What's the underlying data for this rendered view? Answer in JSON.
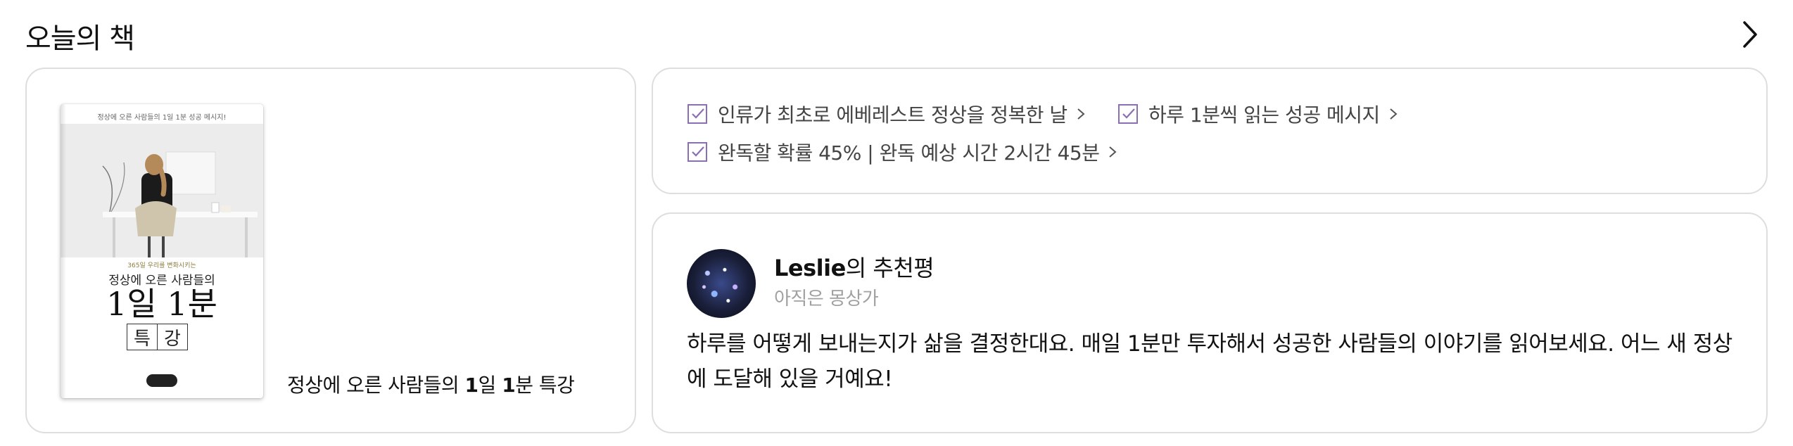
{
  "section": {
    "title": "오늘의 책",
    "more_icon": "chevron-right-icon"
  },
  "book": {
    "cover": {
      "top_text": "정상에 오른 사람들의 1일 1분 성공 메시지!",
      "subtitle": "365일 우리를 변화시키는",
      "title_line1": "정상에 오른 사람들의",
      "title_line2": "1일 1분",
      "title_char1": "특",
      "title_char2": "강"
    },
    "caption_prefix": "정상에 오른 사람들의 ",
    "caption_bold1": "1",
    "caption_mid": "일 ",
    "caption_bold2": "1",
    "caption_suffix": "분 특강"
  },
  "tags": [
    {
      "label": "인류가 최초로 에베레스트 정상을 정복한 날",
      "icon": "checkbox-icon"
    },
    {
      "label": "하루 1분씩 읽는 성공 메시지",
      "icon": "checkbox-icon"
    },
    {
      "label": "완독할 확률 45% | 완독 예상 시간 2시간 45분",
      "icon": "checkbox-icon"
    }
  ],
  "review": {
    "reviewer_name": "Leslie",
    "reviewer_suffix": "의 추천평",
    "reviewer_status": "아직은 몽상가",
    "text": "하루를 어떻게 보내는지가 삶을 결정한대요. 매일 1분만 투자해서 성공한 사람들의 이야기를 읽어보세요. 어느 새 정상에 도달해 있을 거예요!"
  },
  "colors": {
    "accent": "#8b6fb5",
    "border": "#dedede",
    "muted": "#a0a0a0"
  }
}
